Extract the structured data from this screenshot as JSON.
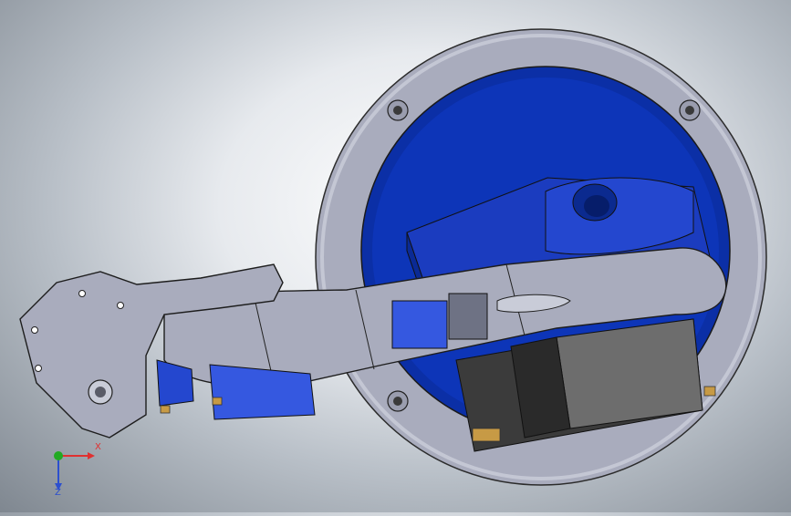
{
  "viewport": {
    "colors": {
      "gray_part": "#a9acbd",
      "gray_shadow": "#8d90a1",
      "blue_face": "#0b2fa6",
      "blue_light": "#3558e0",
      "dark_motor": "#3a3a3a",
      "brass": "#c79a45"
    }
  },
  "triad": {
    "x_label": "X",
    "z_label": "Z",
    "x_color": "#e03030",
    "y_color": "#22aa22",
    "z_color": "#2c4fcf"
  }
}
